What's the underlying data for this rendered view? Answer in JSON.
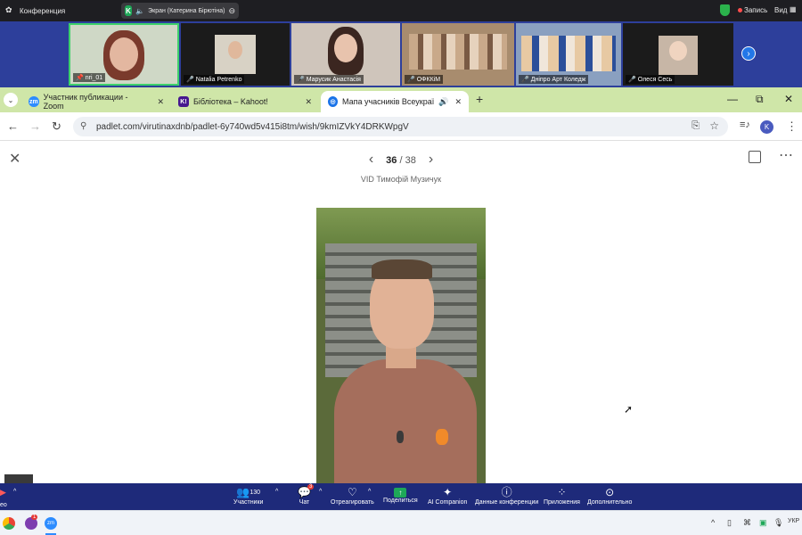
{
  "zoom_top": {
    "app_title": "Конференция",
    "share_label": "Экран (Катерина Бірютіна)",
    "share_badge": "K",
    "record_label": "Запись",
    "view_label": "Вид"
  },
  "participants": [
    {
      "name": "nri_01",
      "pinned": true
    },
    {
      "name": "Natalia Petrenko",
      "muted": true
    },
    {
      "name": "Марусик Анастасія",
      "muted": true
    },
    {
      "name": "ОФККіМ",
      "muted": true
    },
    {
      "name": "Дніпро Арт Коледж",
      "muted": true
    },
    {
      "name": "Олеся Сесь",
      "muted": true
    }
  ],
  "browser": {
    "tabs": [
      {
        "title": "Участник публикации - Zoom",
        "favicon": "zm",
        "favicon_color": "#2d8cff"
      },
      {
        "title": "Бібліотека – Kahoot!",
        "favicon": "K!",
        "favicon_color": "#46178f"
      },
      {
        "title": "Мапа учасників Всеукраїнс",
        "favicon": "globe",
        "favicon_color": "#1a73e8",
        "active": true
      }
    ],
    "url": "padlet.com/virutinaxdnb/padlet-6y740wd5v415i8tm/wish/9kmIZVkY4DRKWpgV",
    "profile_initial": "K"
  },
  "padlet": {
    "current": "36",
    "total": "/ 38",
    "post_title": "VID Тимофій Музичук"
  },
  "zoom_toolbar": {
    "participants_count": "130",
    "chat_badge": "3",
    "items": [
      {
        "label": "Участники",
        "icon": "participants-icon"
      },
      {
        "label": "Чат",
        "icon": "chat-icon"
      },
      {
        "label": "Отреагировать",
        "icon": "heart-icon"
      },
      {
        "label": "Поделиться",
        "icon": "share-icon"
      },
      {
        "label": "AI Companion",
        "icon": "sparkle-icon"
      },
      {
        "label": "Данные конференции",
        "icon": "info-icon"
      },
      {
        "label": "Приложения",
        "icon": "apps-icon"
      },
      {
        "label": "Дополнительно",
        "icon": "more-icon"
      }
    ],
    "left_cut_label": "ео"
  },
  "taskbar": {
    "lang": "УКР",
    "badge_1": "",
    "badge_2": "1"
  },
  "colors": {
    "zoom_strip": "#2d3f9b",
    "zoom_toolbar": "#1e2a7a",
    "browser_tabbar": "#cfe6a8",
    "share_green": "#1ea858"
  }
}
